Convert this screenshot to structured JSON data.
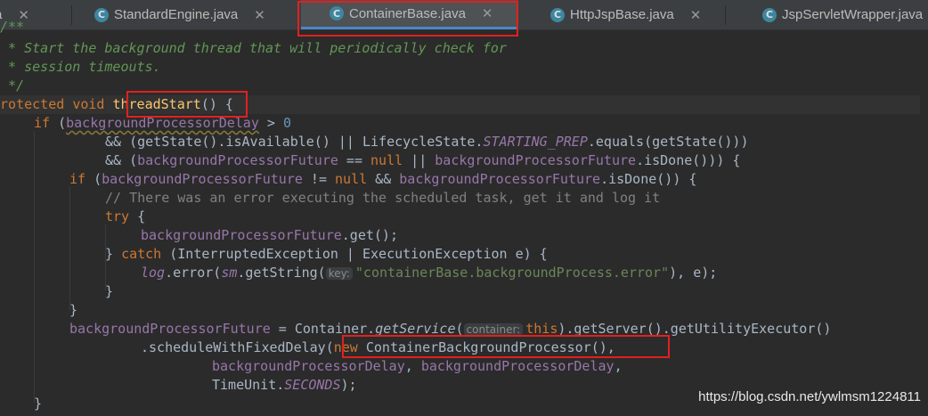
{
  "tabs": [
    {
      "label": "a",
      "icon": "java-class-icon",
      "active": false
    },
    {
      "label": "StandardEngine.java",
      "icon": "java-class-icon",
      "active": false
    },
    {
      "label": "ContainerBase.java",
      "icon": "java-class-icon",
      "active": true
    },
    {
      "label": "HttpJspBase.java",
      "icon": "java-class-icon",
      "active": false
    },
    {
      "label": "JspServletWrapper.java",
      "icon": "java-class-icon",
      "active": false
    }
  ],
  "tab_icon_glyph": "C",
  "close_glyph": "✕",
  "code": {
    "l0": "/**",
    "l1": " * Start the background thread that will periodically check for",
    "l2": " * session timeouts.",
    "l3": " */",
    "l4": {
      "kw1": "protected",
      "kw2": "void",
      "method": "threadStart",
      "rest": "() {"
    },
    "l5": {
      "kw": "if",
      "open": "(",
      "field": "backgroundProcessorDelay",
      "op": " > ",
      "num": "0"
    },
    "l6": {
      "a": "&& (getState().isAvailable() || LifecycleState.",
      "const": "STARTING_PREP",
      "b": ".equals(getState()))"
    },
    "l7": {
      "a": "&& (",
      "f1": "backgroundProcessorFuture",
      "b": " == ",
      "kw": "null",
      "c": " || ",
      "f2": "backgroundProcessorFuture",
      "d": ".isDone())) {"
    },
    "l8": {
      "kw": "if",
      "a": " (",
      "f1": "backgroundProcessorFuture",
      "b": " != ",
      "kwnull": "null",
      "c": " && ",
      "f2": "backgroundProcessorFuture",
      "d": ".isDone()) {"
    },
    "l9": "// There was an error executing the scheduled task, get it and log it",
    "l10": {
      "kw": "try",
      "rest": " {"
    },
    "l11": {
      "field": "backgroundProcessorFuture",
      "rest": ".get();"
    },
    "l12": {
      "a": "} ",
      "kw": "catch",
      "b": " (InterruptedException | ExecutionException e) {"
    },
    "l13": {
      "log": "log",
      "a": ".error(",
      "sm": "sm",
      "b": ".getString(",
      "hint": "key:",
      "str": "\"containerBase.backgroundProcess.error\"",
      "c": "), e);"
    },
    "l14": "}",
    "l15": "}",
    "l16": {
      "field": "backgroundProcessorFuture",
      "a": " = Container.",
      "gs": "getService",
      "b": "(",
      "hint": "container:",
      "kw": "this",
      "c": ").getServer().getUtilityExecutor()"
    },
    "l17": {
      "a": ".scheduleWithFixedDelay(",
      "kw": "new",
      "b": " ContainerBackgroundProcessor(),"
    },
    "l18": {
      "f1": "backgroundProcessorDelay",
      "a": ", ",
      "f2": "backgroundProcessorDelay",
      "b": ","
    },
    "l19": {
      "a": "TimeUnit.",
      "const": "SECONDS",
      "b": ");"
    },
    "l20": "}"
  },
  "watermark": "https://blog.csdn.net/ywlmsm1224811",
  "colors": {
    "keyword": "#cc7832",
    "comment": "#629755",
    "field": "#9876aa",
    "string": "#6a8759",
    "number": "#6897bb",
    "method": "#ffc66d",
    "highlight": "#e41f1f"
  }
}
